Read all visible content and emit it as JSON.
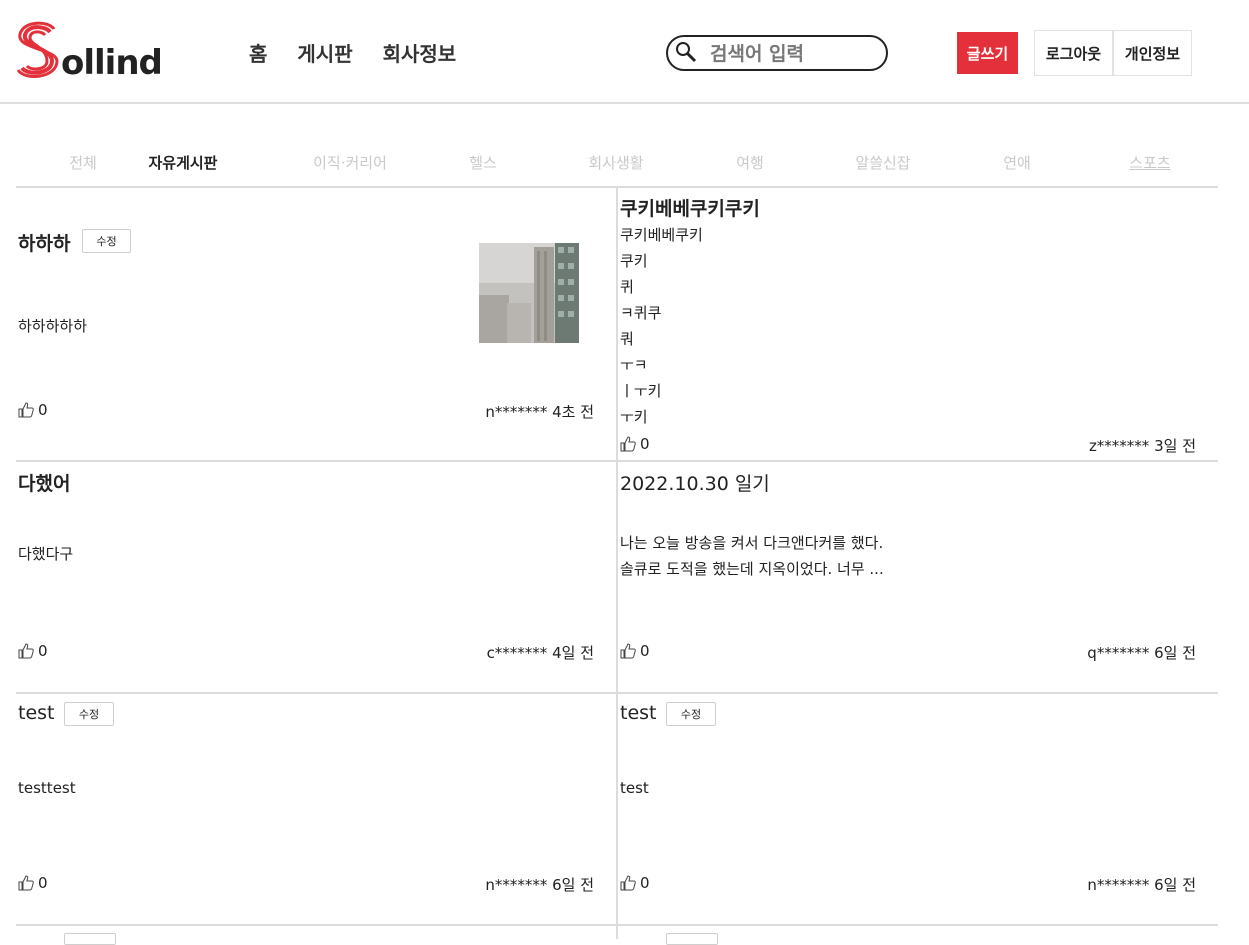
{
  "header": {
    "logo_text": "ollind",
    "nav": [
      "홈",
      "게시판",
      "회사정보"
    ],
    "search_placeholder": "검색어 입력",
    "write_label": "글쓰기",
    "logout_label": "로그아웃",
    "profile_label": "개인정보"
  },
  "categories": [
    "전체",
    "자유게시판",
    "이직·커리어",
    "헬스",
    "회사생활",
    "여행",
    "알쓸신잡",
    "연애",
    "스포츠"
  ],
  "active_category": "자유게시판",
  "posts": [
    {
      "title": "하하하",
      "edit": "수정",
      "body": [
        "하하하하하"
      ],
      "likes": "0",
      "meta": "n******* 4초 전"
    },
    {
      "title": "쿠키베베쿠키쿠키",
      "body": [
        "쿠키베베쿠키",
        "쿠키",
        "퀴",
        "ㅋ퀴쿠",
        "쿼",
        "ㅜㅋ",
        "ㅣㅜ키",
        "ㅜ키"
      ],
      "likes": "0",
      "meta": "z******* 3일 전"
    },
    {
      "title": "다했어",
      "body": [
        "다했다구"
      ],
      "likes": "0",
      "meta": "c******* 4일 전"
    },
    {
      "title": "2022.10.30 일기",
      "body": [
        "나는 오늘 방송을 켜서 다크앤다커를 했다.",
        "솔큐로 도적을 했는데 지옥이었다. 너무 ..."
      ],
      "likes": "0",
      "meta": "q******* 6일 전"
    },
    {
      "title": "test",
      "edit": "수정",
      "body": [
        "testtest"
      ],
      "likes": "0",
      "meta": "n******* 6일 전"
    },
    {
      "title": "test",
      "edit": "수정",
      "body": [
        "test"
      ],
      "likes": "0",
      "meta": "n******* 6일 전"
    }
  ],
  "colors": {
    "brand": "#e3303a",
    "divider": "#dcdcdc"
  }
}
